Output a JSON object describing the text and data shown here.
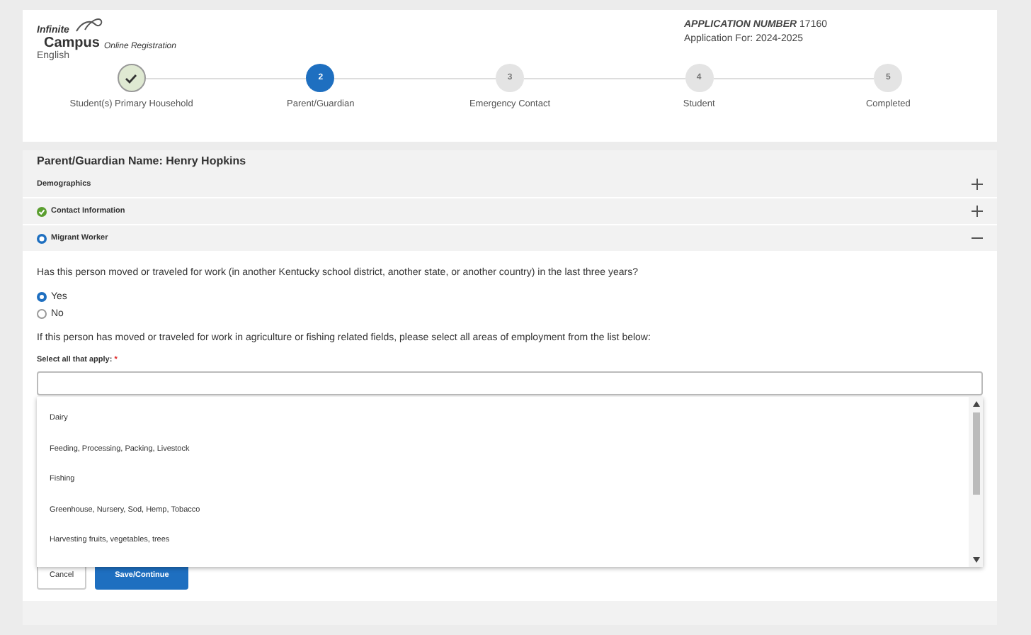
{
  "header": {
    "logo_top": "Infinite",
    "logo_main": "Campus",
    "logo_sub": "Online Registration",
    "language": "English",
    "app_number_label": "APPLICATION NUMBER",
    "app_number": "17160",
    "application_for": "Application For: 2024-2025"
  },
  "steps": [
    {
      "label": "Student(s) Primary Household",
      "kind": "done"
    },
    {
      "label": "Parent/Guardian",
      "number": "2",
      "kind": "current"
    },
    {
      "label": "Emergency Contact",
      "number": "3",
      "kind": "upcoming"
    },
    {
      "label": "Student",
      "number": "4",
      "kind": "upcoming"
    },
    {
      "label": "Completed",
      "number": "5",
      "kind": "upcoming"
    }
  ],
  "section_title": "Parent/Guardian Name: Henry Hopkins",
  "panels": [
    {
      "title": "Demographics",
      "kind": "plain",
      "expanded": false
    },
    {
      "title": "Contact Information",
      "kind": "complete",
      "expanded": false
    },
    {
      "title": "Migrant Worker",
      "kind": "active",
      "expanded": true
    }
  ],
  "question": "Has this person moved or traveled for work (in another Kentucky school district, another state, or another country) in the last three years?",
  "radios": [
    {
      "label": "Yes",
      "selected": true
    },
    {
      "label": "No",
      "selected": false
    }
  ],
  "instruction": "If this person has moved or traveled for work in agriculture or fishing related fields, please select all areas of employment from the list below:",
  "select_label": "Select all that apply:",
  "required_mark": "*",
  "options": [
    "Dairy",
    "Feeding, Processing, Packing, Livestock",
    "Fishing",
    "Greenhouse, Nursery, Sod, Hemp, Tobacco",
    "Harvesting fruits, vegetables, trees"
  ],
  "buttons": [
    {
      "label": "Cancel",
      "kind": "secondary"
    },
    {
      "label": "Save/Continue",
      "kind": "primary"
    }
  ]
}
